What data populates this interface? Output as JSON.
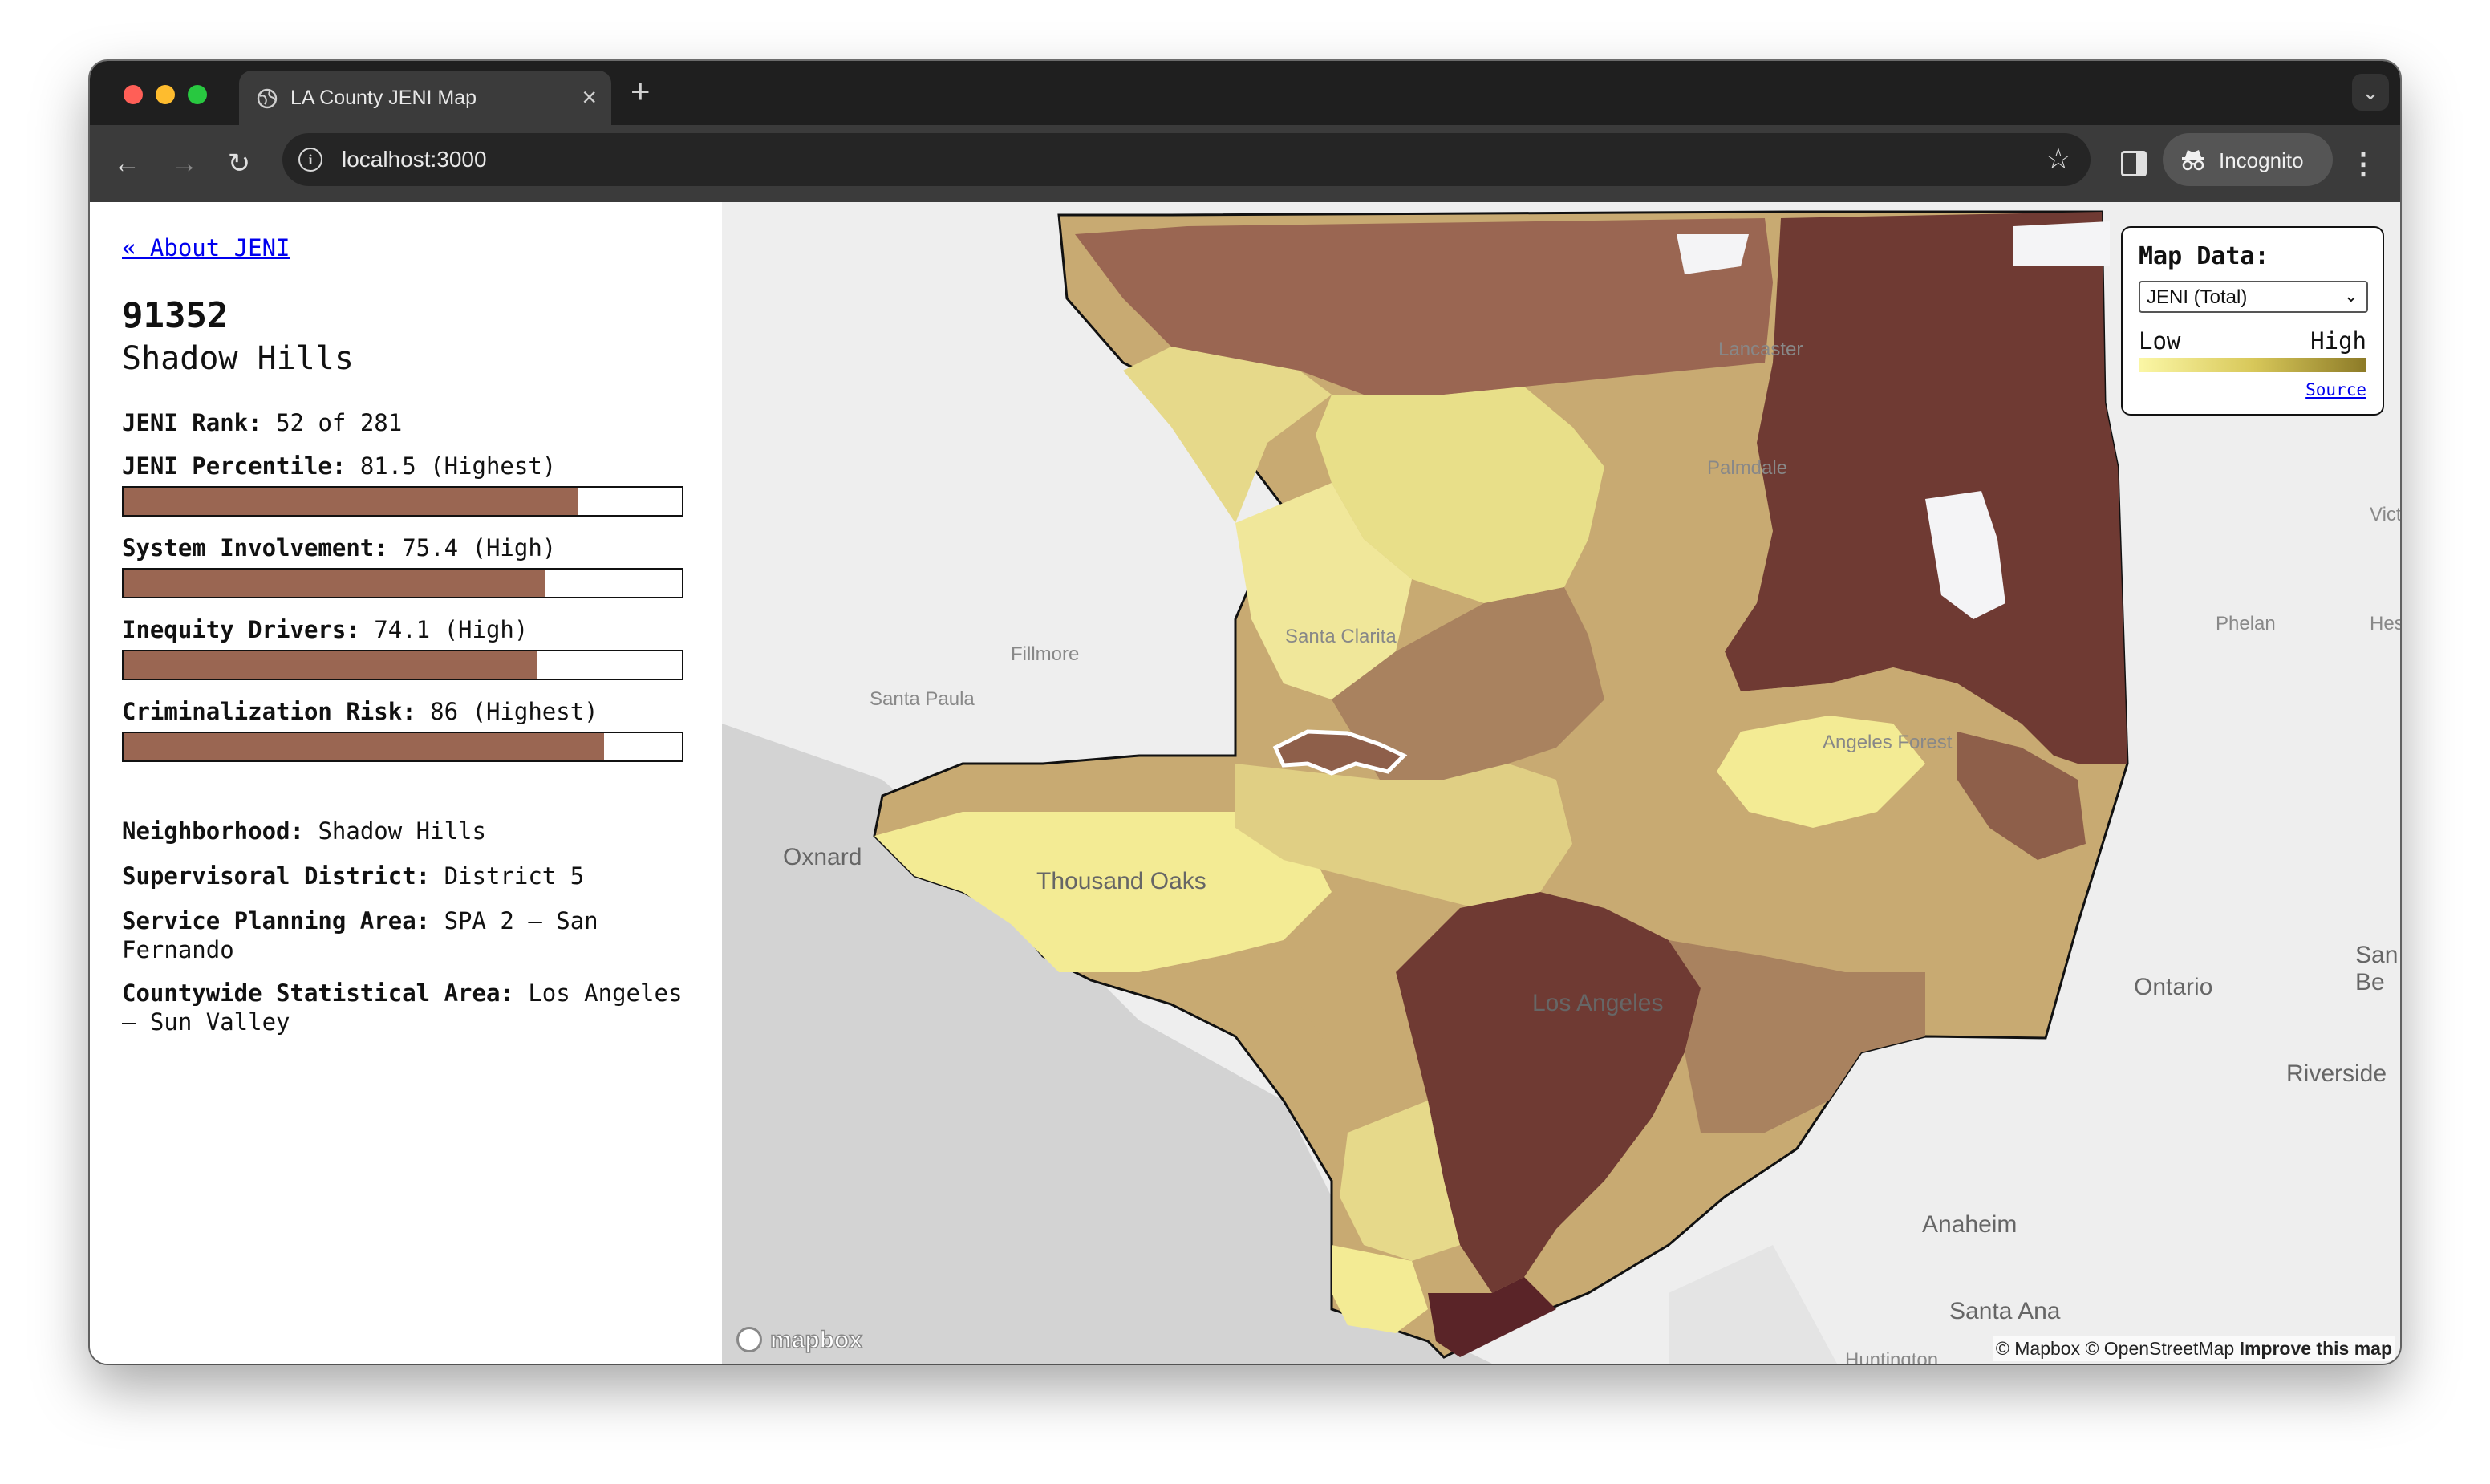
{
  "browser": {
    "tab_title": "LA County JENI Map",
    "tab_close": "×",
    "new_tab": "+",
    "tab_menu": "⌄",
    "url": "localhost:3000",
    "incognito_label": "Incognito",
    "back": "←",
    "forward": "→",
    "reload": "↻",
    "star": "☆",
    "kebab": "⋮",
    "info": "i"
  },
  "sidebar": {
    "about_link": "« About JENI",
    "zip": "91352",
    "place": "Shadow Hills",
    "stats": [
      {
        "label": "JENI Rank:",
        "value": "52 of 281"
      },
      {
        "label": "JENI Percentile:",
        "value": "81.5 (Highest)",
        "percent": 81.5
      },
      {
        "label": "System Involvement:",
        "value": "75.4 (High)",
        "percent": 75.4
      },
      {
        "label": "Inequity Drivers:",
        "value": "74.1 (High)",
        "percent": 74.1
      },
      {
        "label": "Criminalization Risk:",
        "value": "86 (Highest)",
        "percent": 86
      }
    ],
    "meta": [
      {
        "label": "Neighborhood:",
        "value": "Shadow Hills"
      },
      {
        "label": "Supervisoral District:",
        "value": "District 5"
      },
      {
        "label": "Service Planning Area:",
        "value": "SPA 2 – San Fernando"
      },
      {
        "label": "Countywide Statistical Area:",
        "value": "Los Angeles – Sun Valley"
      }
    ],
    "bar_color": "#9a6652"
  },
  "map": {
    "legend_title": "Map Data:",
    "legend_selected": "JENI (Total)",
    "legend_low": "Low",
    "legend_high": "High",
    "legend_source": "Source",
    "places": [
      "Lancaster",
      "Palmdale",
      "Victo",
      "Phelan",
      "Hesp",
      "Fillmore",
      "Santa Paula",
      "Oxnard",
      "Thousand Oaks",
      "Santa Clarita",
      "Los Angeles",
      "Ontario",
      "San Be",
      "Riverside",
      "Anaheim",
      "Santa Ana",
      "Huntington",
      "Angeles Forest"
    ],
    "attribution_prefix": "© Mapbox © OpenStreetMap",
    "attribution_link": "Improve this map",
    "mapbox_word": "mapbox",
    "palette": {
      "low": "#f3eb94",
      "light": "#e6d98a",
      "tan": "#c8aa72",
      "mid": "#a9825f",
      "brown": "#8e5f4a",
      "dark": "#6f3a33",
      "darkest": "#5a2428"
    }
  }
}
